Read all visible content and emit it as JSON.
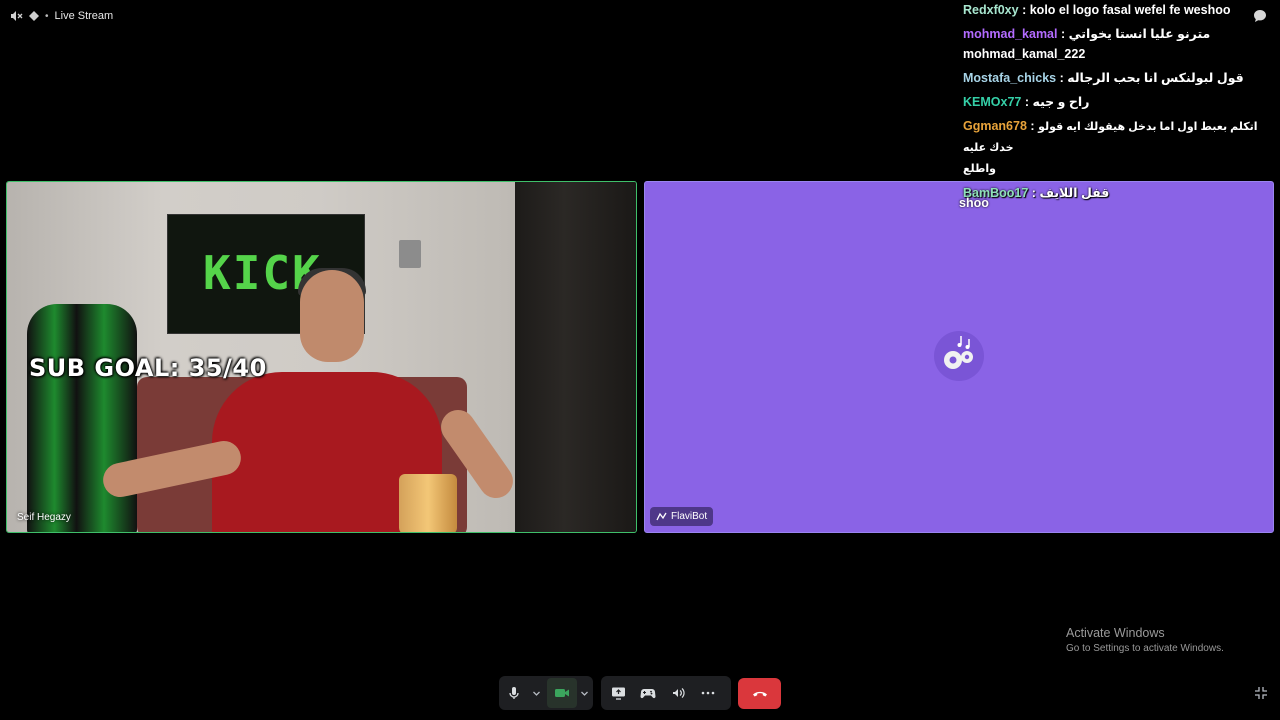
{
  "header": {
    "title": "Live Stream",
    "icons": [
      "speaker-muted-icon",
      "stage-icon"
    ]
  },
  "tiles": [
    {
      "id": "camera",
      "name": "Seif Hegazy",
      "overlay_text": "SUB GOAL: 35/40",
      "banner_text": "KICK",
      "border_color": "#3fbf6a"
    },
    {
      "id": "bot",
      "name": "FlaviBot",
      "icon": "bot-icon",
      "background_color": "#8a63e6"
    }
  ],
  "chat": {
    "messages": [
      {
        "user": "Redxf0xy",
        "sep": ":",
        "text": "kolo el logo fasal wefel fe weshoo",
        "color": "#a8e6cf"
      },
      {
        "user": "mohmad_kamal",
        "sep": ":",
        "text": "مترنو عليا انستا يخواتي",
        "color": "#b36bff"
      },
      {
        "user": "",
        "sep": "",
        "text": "mohmad_kamal_222",
        "color": "#ffffff"
      },
      {
        "user": "Mostafa_chicks",
        "sep": ":",
        "text": "قول لبولنكس انا بحب الرجاله",
        "color": "#a7d3e6"
      },
      {
        "user": "KEMOx77",
        "sep": ":",
        "text": "راح و جيه",
        "color": "#35d0a8"
      },
      {
        "user": "Ggman678",
        "sep": ":",
        "text": "اتكلم بعبط اول اما بدخل هيقولك ايه قولو خدك عليه",
        "color": "#e8a33a"
      },
      {
        "user": "",
        "sep": "",
        "text": "واطلع",
        "color": "#ffffff"
      },
      {
        "user": "BamBoo17",
        "sep": ":",
        "text": "قفل اللايف",
        "color": "#8ee0b8"
      }
    ],
    "trailing": "shoo"
  },
  "watermark": {
    "line1": "Activate Windows",
    "line2": "Go to Settings to activate Windows."
  },
  "controls": {
    "buttons": [
      {
        "name": "microphone",
        "icon": "microphone-icon"
      },
      {
        "name": "microphone-options",
        "icon": "chevron-down-icon"
      },
      {
        "name": "camera",
        "icon": "camera-icon",
        "active": true
      },
      {
        "name": "camera-options",
        "icon": "chevron-down-icon"
      },
      {
        "name": "screen-share",
        "icon": "screen-share-icon"
      },
      {
        "name": "activities",
        "icon": "gamepad-icon"
      },
      {
        "name": "soundboard",
        "icon": "soundboard-icon"
      },
      {
        "name": "more",
        "icon": "more-icon"
      },
      {
        "name": "disconnect",
        "icon": "hang-up-icon"
      }
    ],
    "accent_active": "#3ba55d",
    "hangup_color": "#da373c"
  }
}
